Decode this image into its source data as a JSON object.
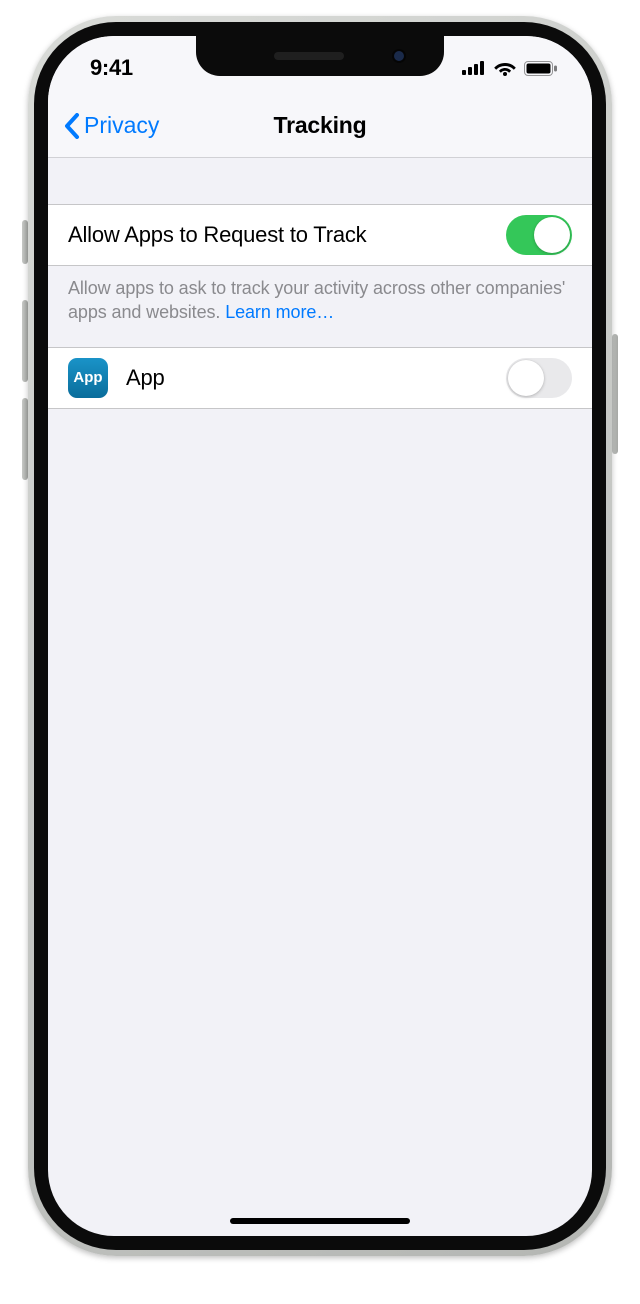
{
  "status": {
    "time": "9:41"
  },
  "nav": {
    "back_label": "Privacy",
    "title": "Tracking"
  },
  "main_toggle": {
    "label": "Allow Apps to Request to Track",
    "on": true
  },
  "footer": {
    "text": "Allow apps to ask to track your activity across other companies' apps and websites. ",
    "link": "Learn more…"
  },
  "apps": [
    {
      "icon_text": "App",
      "name": "App",
      "on": false
    }
  ]
}
